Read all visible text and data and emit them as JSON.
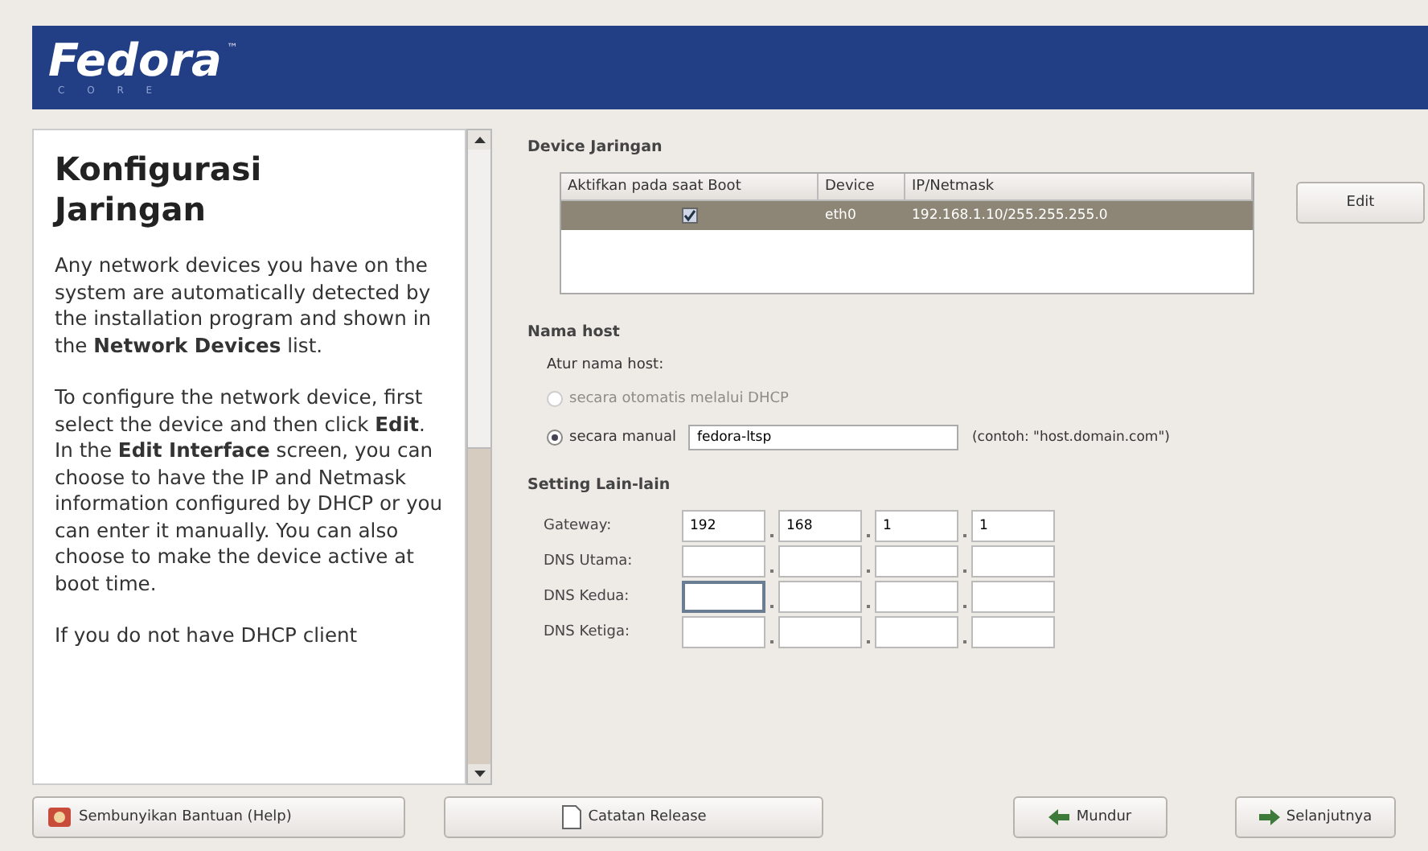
{
  "header": {
    "logo": "Fedora",
    "logo_sub": "C O R E",
    "trademark": "™"
  },
  "help": {
    "title": "Konfigurasi Jaringan",
    "paragraphs": [
      "Any network devices you have on the system are automatically detected by the installation program and shown in the **Network Devices** list.",
      "To configure the network device, first select the device and then click **Edit**. In the **Edit Interface** screen, you can choose to have the IP and Netmask information configured by DHCP or you can enter it manually. You can also choose to make the device active at boot time.",
      "If you do not have DHCP client"
    ]
  },
  "devices": {
    "heading": "Device Jaringan",
    "columns": [
      "Aktifkan pada saat Boot",
      "Device",
      "IP/Netmask"
    ],
    "rows": [
      {
        "checked": true,
        "selected": true,
        "device": "eth0",
        "ip": "192.168.1.10/255.255.255.0"
      }
    ],
    "edit_button": "Edit"
  },
  "hostname": {
    "heading": "Nama host",
    "label": "Atur nama host:",
    "options": [
      {
        "label": "secara otomatis melalui DHCP",
        "selected": false,
        "disabled": true
      },
      {
        "label": "secara manual",
        "selected": true,
        "disabled": false
      }
    ],
    "value": "fedora-ltsp",
    "hint": "(contoh: \"host.domain.com\")"
  },
  "other": {
    "heading": "Setting Lain-lain",
    "rows": [
      {
        "label": "Gateway:",
        "octets": [
          {
            "value": "192",
            "focused": false
          },
          {
            "value": "168",
            "focused": false
          },
          {
            "value": "1",
            "focused": false
          },
          {
            "value": "1",
            "focused": false
          }
        ]
      },
      {
        "label": "DNS Utama:",
        "octets": [
          {
            "focused": false
          },
          {
            "focused": false
          },
          {
            "focused": false
          },
          {
            "focused": false
          }
        ]
      },
      {
        "label": "DNS Kedua:",
        "octets": [
          {
            "focused": true
          },
          {
            "focused": false
          },
          {
            "focused": false
          },
          {
            "focused": false
          }
        ]
      },
      {
        "label": "DNS Ketiga:",
        "octets": [
          {
            "focused": false
          },
          {
            "focused": false
          },
          {
            "focused": false
          },
          {
            "focused": false
          }
        ]
      }
    ]
  },
  "buttons": [
    {
      "kind": "help",
      "label": "Sembunyikan Bantuan (Help)"
    },
    {
      "kind": "notes",
      "label": "Catatan Release"
    },
    {
      "kind": "back",
      "label": "Mundur"
    },
    {
      "kind": "next",
      "label": "Selanjutnya"
    }
  ]
}
